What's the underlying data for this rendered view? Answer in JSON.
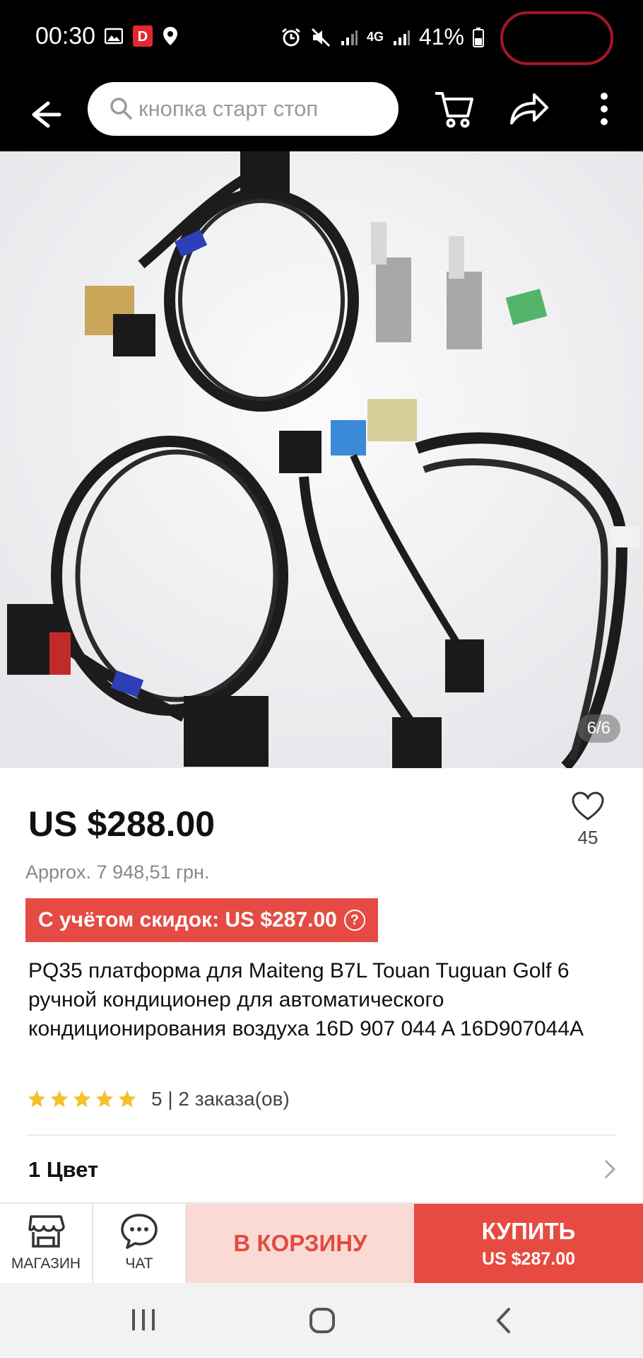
{
  "status_bar": {
    "time": "00:30",
    "network": "4G",
    "battery": "41%"
  },
  "search": {
    "placeholder": "кнопка старт стоп"
  },
  "gallery": {
    "counter": "6/6"
  },
  "product": {
    "price": "US $288.00",
    "approx": "Approx. 7 948,51 грн.",
    "discount": "С учётом скидок: US $287.00",
    "discount_help": "?",
    "title": "PQ35 платформа для Maiteng B7L Touan Tuguan Golf 6 ручной кондиционер для автоматического кондиционирования воздуха 16D 907 044 A 16D907044A",
    "wishlist_count": "45",
    "rating": "5",
    "orders": "| 2 заказа(ов)",
    "stars": 5
  },
  "options": {
    "color_label": "1 Цвет"
  },
  "bottom_bar": {
    "store": "МАГАЗИН",
    "chat": "ЧАТ",
    "add_to_cart": "В КОРЗИНУ",
    "buy": "КУПИТЬ",
    "buy_price": "US $287.00"
  },
  "colors": {
    "accent": "#e64a41",
    "cart_bg": "#fbdad6",
    "star": "#f5c02b"
  }
}
